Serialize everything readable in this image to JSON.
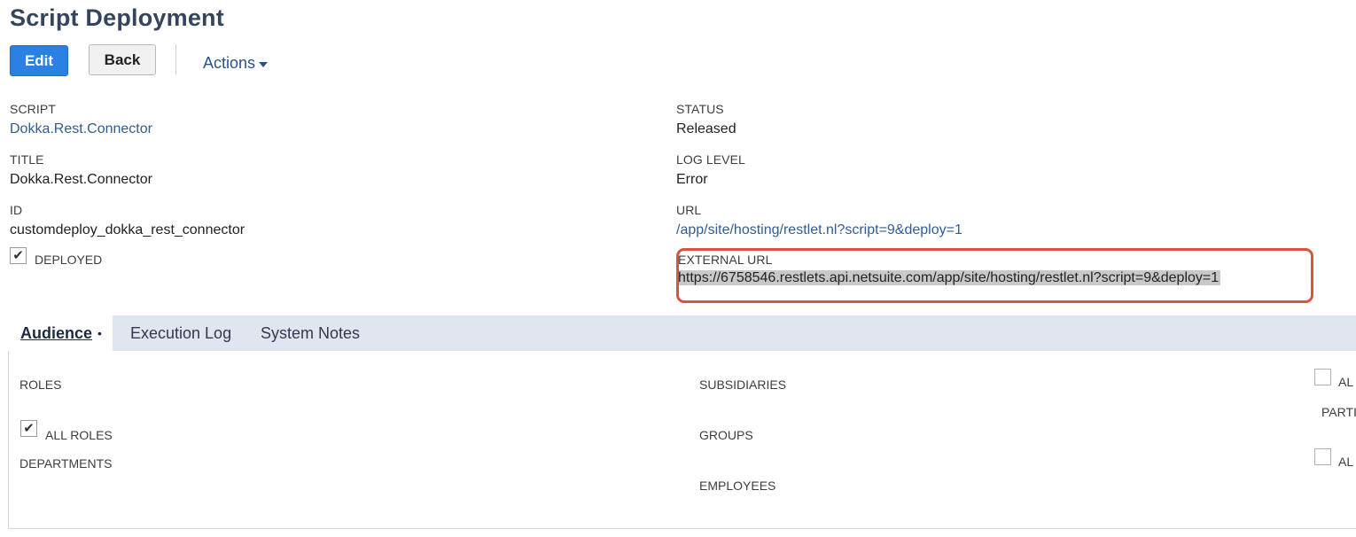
{
  "page": {
    "title": "Script Deployment"
  },
  "toolbar": {
    "edit_label": "Edit",
    "back_label": "Back",
    "actions_label": "Actions"
  },
  "fields": {
    "script": {
      "label": "SCRIPT",
      "value": "Dokka.Rest.Connector"
    },
    "title": {
      "label": "TITLE",
      "value": "Dokka.Rest.Connector"
    },
    "id": {
      "label": "ID",
      "value": "customdeploy_dokka_rest_connector"
    },
    "deployed": {
      "label": "DEPLOYED",
      "checked": true
    },
    "status": {
      "label": "STATUS",
      "value": "Released"
    },
    "log_level": {
      "label": "LOG LEVEL",
      "value": "Error"
    },
    "url": {
      "label": "URL",
      "value": "/app/site/hosting/restlet.nl?script=9&deploy=1"
    },
    "external_url": {
      "label": "EXTERNAL URL",
      "value": "https://6758546.restlets.api.netsuite.com/app/site/hosting/restlet.nl?script=9&deploy=1"
    }
  },
  "tabs": [
    {
      "label": "Audience",
      "active": true,
      "marker": "•"
    },
    {
      "label": "Execution Log",
      "active": false
    },
    {
      "label": "System Notes",
      "active": false
    }
  ],
  "audience": {
    "roles_label": "ROLES",
    "all_roles_label": "ALL ROLES",
    "all_roles_checked": true,
    "departments_label": "DEPARTMENTS",
    "subsidiaries_label": "SUBSIDIARIES",
    "groups_label": "GROUPS",
    "employees_label": "EMPLOYEES",
    "right_col_top_label": "AL",
    "right_col_partners_label": "PARTI",
    "right_col_bottom_label": "AL"
  },
  "colors": {
    "title": "#35455e",
    "edit_button": "#2b80e3",
    "link": "#2f5d96",
    "tab_bar": "#e0e6ef",
    "highlight": "#d9533e"
  },
  "icons": {
    "checkmark": "checkmark-icon",
    "caret": "caret-down-icon"
  }
}
